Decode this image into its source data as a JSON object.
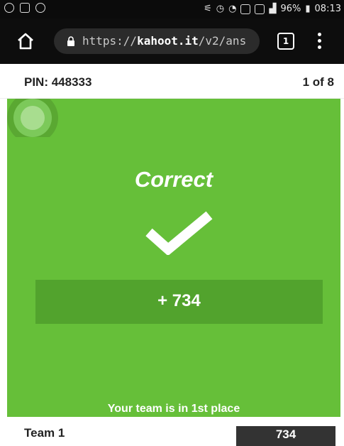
{
  "status_bar": {
    "battery": "96%",
    "time": "08:13",
    "icons": [
      "whatsapp-icon",
      "gallery-icon",
      "eye-icon",
      "nfc-icon",
      "alarm-icon",
      "wifi-icon",
      "data-icon",
      "gallery-icon",
      "signal-icon",
      "battery-icon"
    ]
  },
  "browser": {
    "url_prefix": "https://",
    "url_domain": "kahoot.it",
    "url_path": "/v2/ans",
    "tab_count": "1"
  },
  "game": {
    "pin_label": "PIN: 448333",
    "progress": "1 of 8",
    "result": "Correct",
    "points": "+ 734",
    "place_text": "Your team is in 1st place"
  },
  "footer": {
    "team_name": "Team 1",
    "team_score": "734"
  },
  "colors": {
    "correct_green": "#66bf39",
    "points_bg": "#52a32d",
    "score_bg": "#333333"
  }
}
